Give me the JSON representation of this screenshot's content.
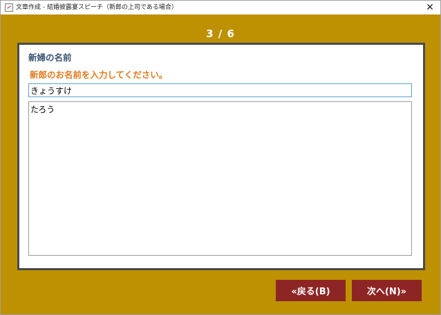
{
  "window": {
    "title": "文章作成 - 結婚披露宴スピーチ（新郎の上司である場合）",
    "close_label": "✕"
  },
  "wizard": {
    "step_current": 3,
    "step_total": 6,
    "step_text": "3 / 6"
  },
  "form": {
    "field_label": "新婦の名前",
    "instruction": "新郎のお名前を入力してください。",
    "name_value": "きょうすけ",
    "notes_value": "たろう"
  },
  "buttons": {
    "back_label": "«戻る(B)",
    "next_label": "次へ(N)»"
  },
  "colors": {
    "background": "#bd9102",
    "panel_border": "#4a4a4a",
    "label": "#3b5472",
    "instruction": "#e07a1f",
    "button": "#8e2525"
  },
  "icons": {
    "app": "document-edit-icon",
    "close": "close-icon"
  }
}
